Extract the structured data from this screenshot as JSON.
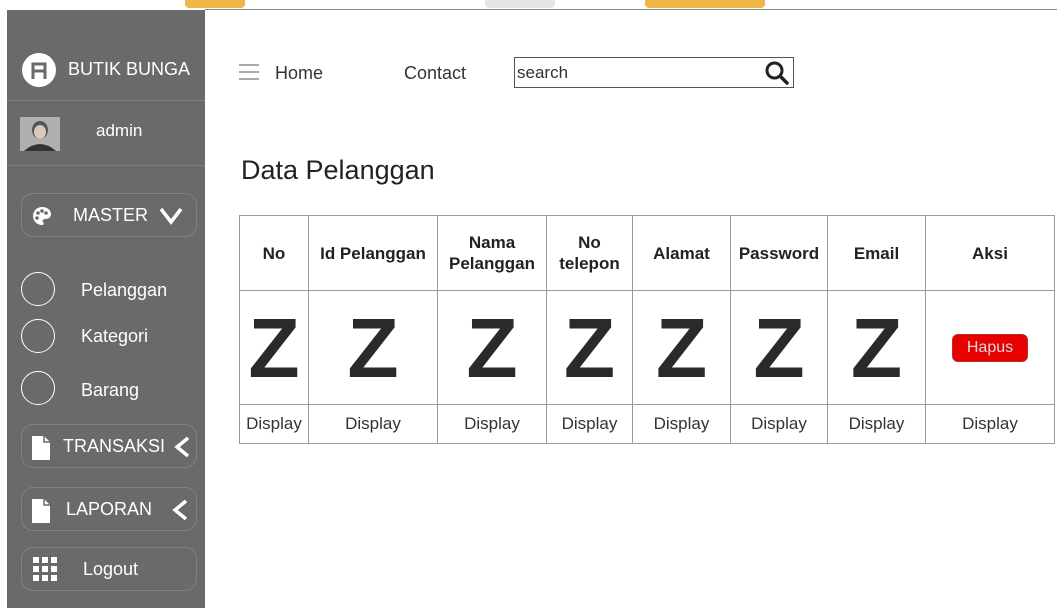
{
  "sidebar": {
    "brand": "BUTIK BUNGA",
    "user": "admin",
    "menu": {
      "master": "MASTER",
      "items": [
        "Pelanggan",
        "Kategori",
        "Barang"
      ],
      "transaksi": "TRANSAKSI",
      "laporan": "LAPORAN",
      "logout": "Logout"
    }
  },
  "nav": {
    "home": "Home",
    "contact": "Contact",
    "search_placeholder": "search"
  },
  "page": {
    "title": "Data Pelanggan"
  },
  "table": {
    "headers": [
      "No",
      "Id Pelanggan",
      "Nama Pelanggan",
      "No telepon",
      "Alamat",
      "Password",
      "Email",
      "Aksi"
    ],
    "placeholder_glyph": "Z",
    "action_button": "Hapus",
    "display_label": "Display"
  },
  "colors": {
    "sidebar": "#6a6a6a",
    "delete_button": "#e60000"
  }
}
